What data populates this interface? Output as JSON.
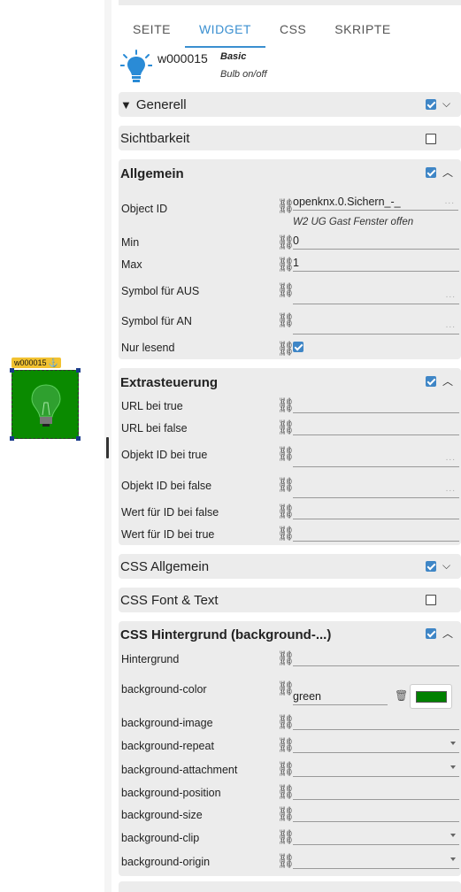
{
  "widget": {
    "id": "w000015",
    "anchor_icon": "anchor-icon",
    "bg_color": "#0a8a00"
  },
  "tabs": [
    "SEITE",
    "WIDGET",
    "CSS",
    "SKRIPTE"
  ],
  "active_tab": "WIDGET",
  "info": {
    "widget_id": "w000015",
    "set": "Basic",
    "description": "Bulb on/off"
  },
  "sections": {
    "generell": {
      "title": "Generell",
      "checked": true
    },
    "sichtbarkeit": {
      "title": "Sichtbarkeit",
      "checked": false
    },
    "allgemein": {
      "title": "Allgemein",
      "checked": true,
      "object_id": {
        "label": "Object ID",
        "value": "openknx.0.Sichern_-_",
        "hint": "W2 UG Gast Fenster offen"
      },
      "min": {
        "label": "Min",
        "value": "0"
      },
      "max": {
        "label": "Max",
        "value": "1"
      },
      "symbol_aus": {
        "label": "Symbol für AUS",
        "value": ""
      },
      "symbol_an": {
        "label": "Symbol für AN",
        "value": ""
      },
      "nur_lesend": {
        "label": "Nur lesend",
        "checked": true
      }
    },
    "extrasteuerung": {
      "title": "Extrasteuerung",
      "checked": true,
      "url_true": {
        "label": "URL bei true",
        "value": ""
      },
      "url_false": {
        "label": "URL bei false",
        "value": ""
      },
      "oid_true": {
        "label": "Objekt ID bei true",
        "value": ""
      },
      "oid_false": {
        "label": "Objekt ID bei false",
        "value": ""
      },
      "wert_false": {
        "label": "Wert für ID bei false",
        "value": ""
      },
      "wert_true": {
        "label": "Wert für ID bei true",
        "value": ""
      }
    },
    "css_allgemein": {
      "title": "CSS Allgemein",
      "checked": true
    },
    "css_font": {
      "title": "CSS Font & Text",
      "checked": false
    },
    "css_bg": {
      "title": "CSS Hintergrund (background-...)",
      "checked": true,
      "hintergrund": {
        "label": "Hintergrund",
        "value": ""
      },
      "bg_color": {
        "label": "background-color",
        "value": "green",
        "swatch": "#008000"
      },
      "bg_image": {
        "label": "background-image",
        "value": ""
      },
      "bg_repeat": {
        "label": "background-repeat",
        "value": ""
      },
      "bg_attachment": {
        "label": "background-attachment",
        "value": ""
      },
      "bg_position": {
        "label": "background-position",
        "value": ""
      },
      "bg_size": {
        "label": "background-size",
        "value": ""
      },
      "bg_clip": {
        "label": "background-clip",
        "value": ""
      },
      "bg_origin": {
        "label": "background-origin",
        "value": ""
      }
    }
  },
  "dots": "..."
}
